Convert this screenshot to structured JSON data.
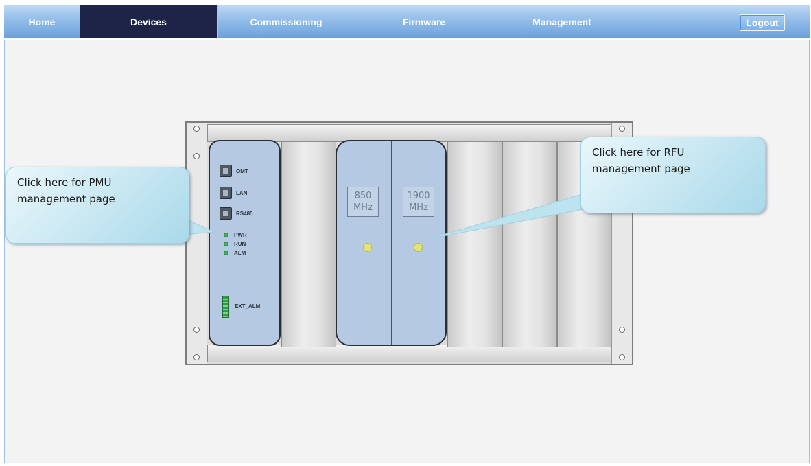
{
  "nav": {
    "items": [
      {
        "label": "Home"
      },
      {
        "label": "Devices",
        "active": true
      },
      {
        "label": "Commissioning"
      },
      {
        "label": "Firmware"
      },
      {
        "label": "Management"
      }
    ],
    "logout_label": "Logout"
  },
  "pmu": {
    "ports": [
      "OMT",
      "LAN",
      "RS485"
    ],
    "leds": [
      "PWR",
      "RUN",
      "ALM"
    ],
    "ext_label": "EXT_ALM"
  },
  "rfu": {
    "band_850": {
      "value": "850",
      "unit": "MHz"
    },
    "band_1900": {
      "value": "1900",
      "unit": "MHz"
    }
  },
  "callouts": {
    "pmu": "Click here for PMU\nmanagement page",
    "rfu": "Click here for RFU\nmanagement page"
  },
  "colors": {
    "nav_active": "#1d2447",
    "module_fill": "#b5c9e2",
    "led_green": "#3db35a",
    "callout_fill": "#a9d9ea"
  }
}
